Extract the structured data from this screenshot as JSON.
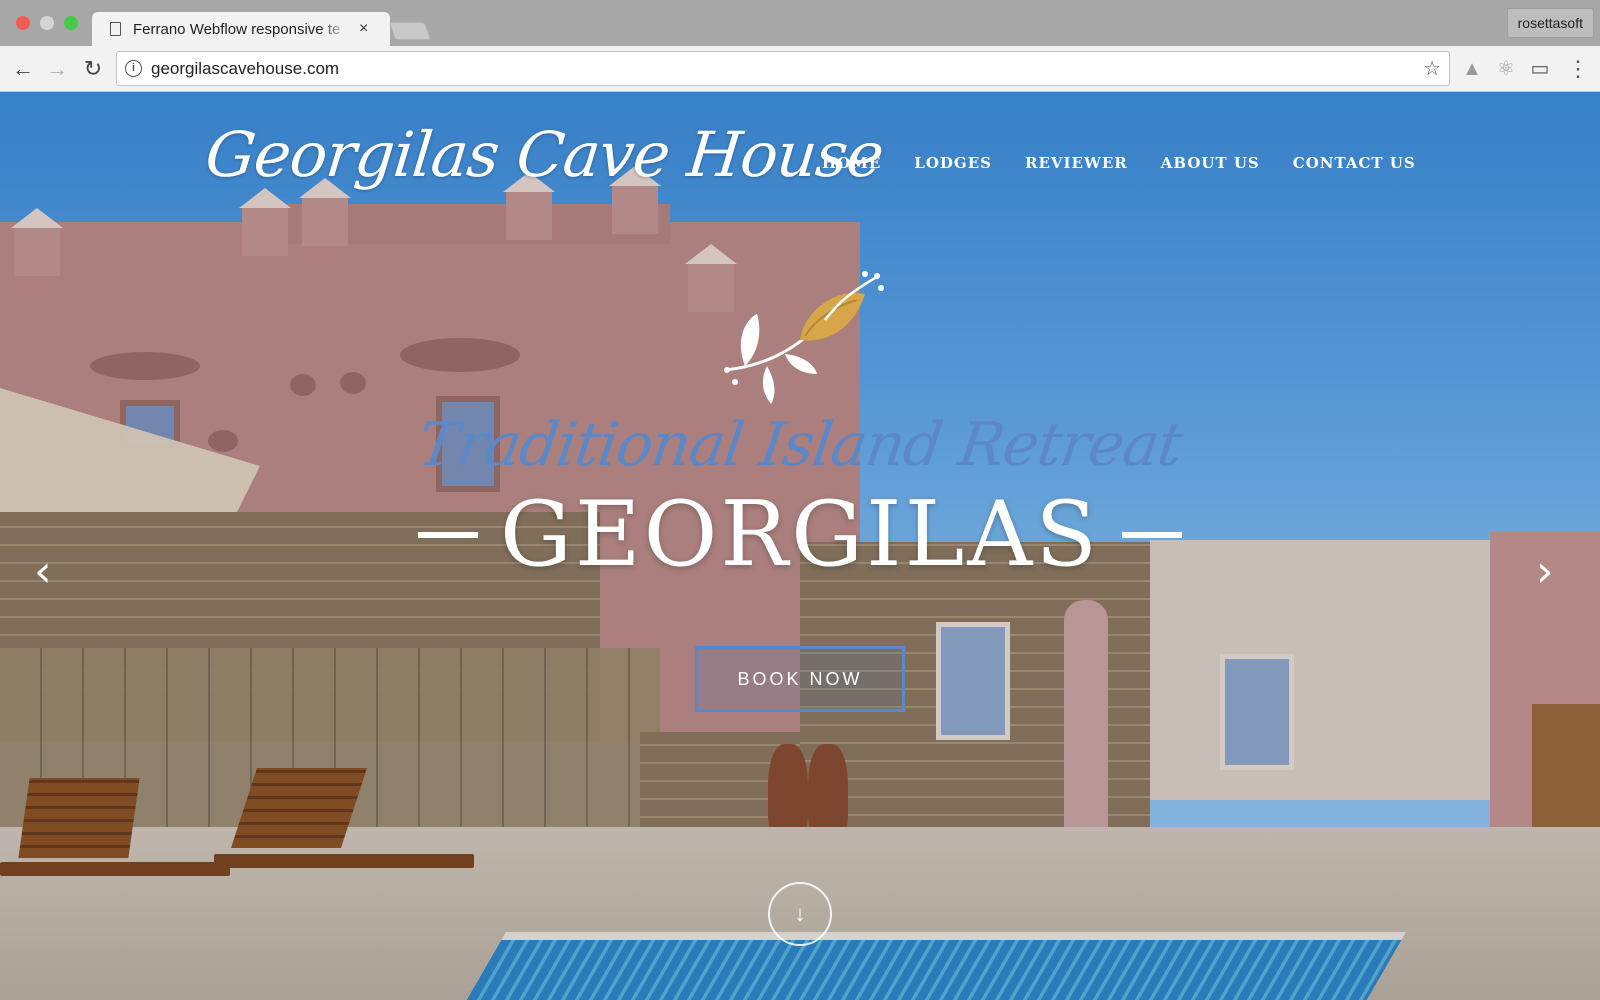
{
  "browser": {
    "tab_title": "Ferrano Webflow responsive te",
    "tab_close": "×",
    "profile_name": "rosettasoft",
    "url": "georgilascavehouse.com",
    "icons": {
      "back": "←",
      "forward": "→",
      "reload": "↻",
      "info": "i",
      "star": "☆",
      "drive": "▲",
      "atom": "⚛",
      "cast": "▭",
      "menu": "⋮"
    }
  },
  "site": {
    "logo_text": "Georgilas Cave House",
    "nav": [
      "HOME",
      "LODGES",
      "REVIEWER",
      "ABOUT US",
      "CONTACT US"
    ],
    "hero": {
      "tagline": "Traditional Island Retreat",
      "title": "GEORGILAS",
      "cta_label": "BOOK NOW",
      "prev_arrow": "‹",
      "next_arrow": "›",
      "scroll_icon": "↓"
    }
  },
  "colors": {
    "accent_blue": "#5c88c8",
    "ornament_gold": "#d8a64a",
    "sky": "#5aa2e6"
  }
}
